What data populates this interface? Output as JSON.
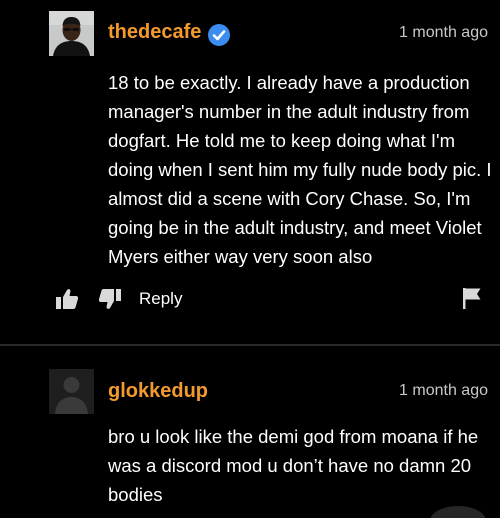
{
  "comments": [
    {
      "username": "thedecafe",
      "verified": true,
      "timestamp": "1 month ago",
      "text": "18 to be exactly. I already have a production manager's number in the adult industry from dogfart. He told me to keep doing what I'm doing when I sent him my fully nude body pic. I almost did a scene with Cory Chase. So, I'm going be in the adult industry, and meet Violet Myers either way very soon also",
      "actions": {
        "thumbs_up_icon": "thumbs-up-icon",
        "thumbs_down_icon": "thumbs-down-icon",
        "reply_label": "Reply",
        "flag_icon": "flag-icon"
      }
    },
    {
      "username": "glokkedup",
      "timestamp": "1 month ago",
      "text": "bro u look like the demi god from moana if he was a discord mod u don’t have no damn 20 bodies"
    }
  ],
  "colors": {
    "background": "#000000",
    "username": "#f39a2e",
    "verified_badge": "#3b8ef0",
    "text": "#ffffff",
    "timestamp": "#c9c9c9"
  }
}
